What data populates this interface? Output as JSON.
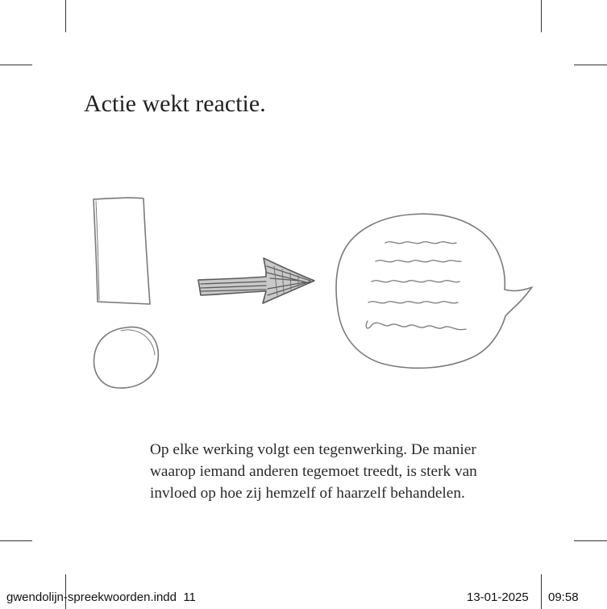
{
  "page": {
    "heading": "Actie wekt reactie.",
    "body_lines": [
      "Op elke werking volgt een tegenwerking. De manier",
      "waarop iemand anderen tegemoet treedt, is sterk van",
      "invloed op hoe zij hemzelf of haarzelf behandelen."
    ]
  },
  "slug": {
    "file": "gwendolijn-spreekwoorden.indd",
    "page_number": "11",
    "date": "13-01-2025",
    "time": "09:58"
  },
  "illustration": {
    "symbols": [
      "exclamation-mark-icon",
      "arrow-right-icon",
      "speech-bubble-icon"
    ],
    "stroke_color": "#7a7a7a"
  }
}
